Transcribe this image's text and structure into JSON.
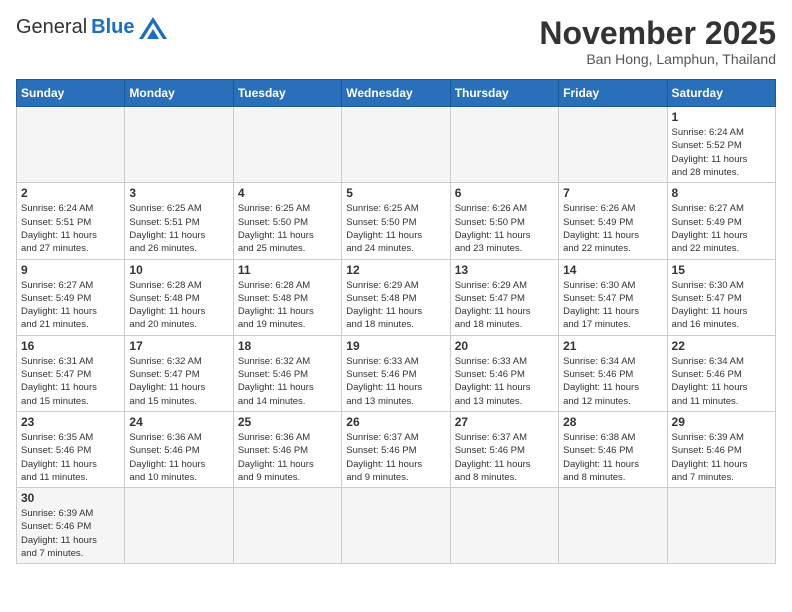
{
  "header": {
    "logo_general": "General",
    "logo_blue": "Blue",
    "month": "November 2025",
    "location": "Ban Hong, Lamphun, Thailand"
  },
  "weekdays": [
    "Sunday",
    "Monday",
    "Tuesday",
    "Wednesday",
    "Thursday",
    "Friday",
    "Saturday"
  ],
  "weeks": [
    [
      {
        "day": "",
        "info": ""
      },
      {
        "day": "",
        "info": ""
      },
      {
        "day": "",
        "info": ""
      },
      {
        "day": "",
        "info": ""
      },
      {
        "day": "",
        "info": ""
      },
      {
        "day": "",
        "info": ""
      },
      {
        "day": "1",
        "info": "Sunrise: 6:24 AM\nSunset: 5:52 PM\nDaylight: 11 hours\nand 28 minutes."
      }
    ],
    [
      {
        "day": "2",
        "info": "Sunrise: 6:24 AM\nSunset: 5:51 PM\nDaylight: 11 hours\nand 27 minutes."
      },
      {
        "day": "3",
        "info": "Sunrise: 6:25 AM\nSunset: 5:51 PM\nDaylight: 11 hours\nand 26 minutes."
      },
      {
        "day": "4",
        "info": "Sunrise: 6:25 AM\nSunset: 5:50 PM\nDaylight: 11 hours\nand 25 minutes."
      },
      {
        "day": "5",
        "info": "Sunrise: 6:25 AM\nSunset: 5:50 PM\nDaylight: 11 hours\nand 24 minutes."
      },
      {
        "day": "6",
        "info": "Sunrise: 6:26 AM\nSunset: 5:50 PM\nDaylight: 11 hours\nand 23 minutes."
      },
      {
        "day": "7",
        "info": "Sunrise: 6:26 AM\nSunset: 5:49 PM\nDaylight: 11 hours\nand 22 minutes."
      },
      {
        "day": "8",
        "info": "Sunrise: 6:27 AM\nSunset: 5:49 PM\nDaylight: 11 hours\nand 22 minutes."
      }
    ],
    [
      {
        "day": "9",
        "info": "Sunrise: 6:27 AM\nSunset: 5:49 PM\nDaylight: 11 hours\nand 21 minutes."
      },
      {
        "day": "10",
        "info": "Sunrise: 6:28 AM\nSunset: 5:48 PM\nDaylight: 11 hours\nand 20 minutes."
      },
      {
        "day": "11",
        "info": "Sunrise: 6:28 AM\nSunset: 5:48 PM\nDaylight: 11 hours\nand 19 minutes."
      },
      {
        "day": "12",
        "info": "Sunrise: 6:29 AM\nSunset: 5:48 PM\nDaylight: 11 hours\nand 18 minutes."
      },
      {
        "day": "13",
        "info": "Sunrise: 6:29 AM\nSunset: 5:47 PM\nDaylight: 11 hours\nand 18 minutes."
      },
      {
        "day": "14",
        "info": "Sunrise: 6:30 AM\nSunset: 5:47 PM\nDaylight: 11 hours\nand 17 minutes."
      },
      {
        "day": "15",
        "info": "Sunrise: 6:30 AM\nSunset: 5:47 PM\nDaylight: 11 hours\nand 16 minutes."
      }
    ],
    [
      {
        "day": "16",
        "info": "Sunrise: 6:31 AM\nSunset: 5:47 PM\nDaylight: 11 hours\nand 15 minutes."
      },
      {
        "day": "17",
        "info": "Sunrise: 6:32 AM\nSunset: 5:47 PM\nDaylight: 11 hours\nand 15 minutes."
      },
      {
        "day": "18",
        "info": "Sunrise: 6:32 AM\nSunset: 5:46 PM\nDaylight: 11 hours\nand 14 minutes."
      },
      {
        "day": "19",
        "info": "Sunrise: 6:33 AM\nSunset: 5:46 PM\nDaylight: 11 hours\nand 13 minutes."
      },
      {
        "day": "20",
        "info": "Sunrise: 6:33 AM\nSunset: 5:46 PM\nDaylight: 11 hours\nand 13 minutes."
      },
      {
        "day": "21",
        "info": "Sunrise: 6:34 AM\nSunset: 5:46 PM\nDaylight: 11 hours\nand 12 minutes."
      },
      {
        "day": "22",
        "info": "Sunrise: 6:34 AM\nSunset: 5:46 PM\nDaylight: 11 hours\nand 11 minutes."
      }
    ],
    [
      {
        "day": "23",
        "info": "Sunrise: 6:35 AM\nSunset: 5:46 PM\nDaylight: 11 hours\nand 11 minutes."
      },
      {
        "day": "24",
        "info": "Sunrise: 6:36 AM\nSunset: 5:46 PM\nDaylight: 11 hours\nand 10 minutes."
      },
      {
        "day": "25",
        "info": "Sunrise: 6:36 AM\nSunset: 5:46 PM\nDaylight: 11 hours\nand 9 minutes."
      },
      {
        "day": "26",
        "info": "Sunrise: 6:37 AM\nSunset: 5:46 PM\nDaylight: 11 hours\nand 9 minutes."
      },
      {
        "day": "27",
        "info": "Sunrise: 6:37 AM\nSunset: 5:46 PM\nDaylight: 11 hours\nand 8 minutes."
      },
      {
        "day": "28",
        "info": "Sunrise: 6:38 AM\nSunset: 5:46 PM\nDaylight: 11 hours\nand 8 minutes."
      },
      {
        "day": "29",
        "info": "Sunrise: 6:39 AM\nSunset: 5:46 PM\nDaylight: 11 hours\nand 7 minutes."
      }
    ],
    [
      {
        "day": "30",
        "info": "Sunrise: 6:39 AM\nSunset: 5:46 PM\nDaylight: 11 hours\nand 7 minutes."
      },
      {
        "day": "",
        "info": ""
      },
      {
        "day": "",
        "info": ""
      },
      {
        "day": "",
        "info": ""
      },
      {
        "day": "",
        "info": ""
      },
      {
        "day": "",
        "info": ""
      },
      {
        "day": "",
        "info": ""
      }
    ]
  ]
}
